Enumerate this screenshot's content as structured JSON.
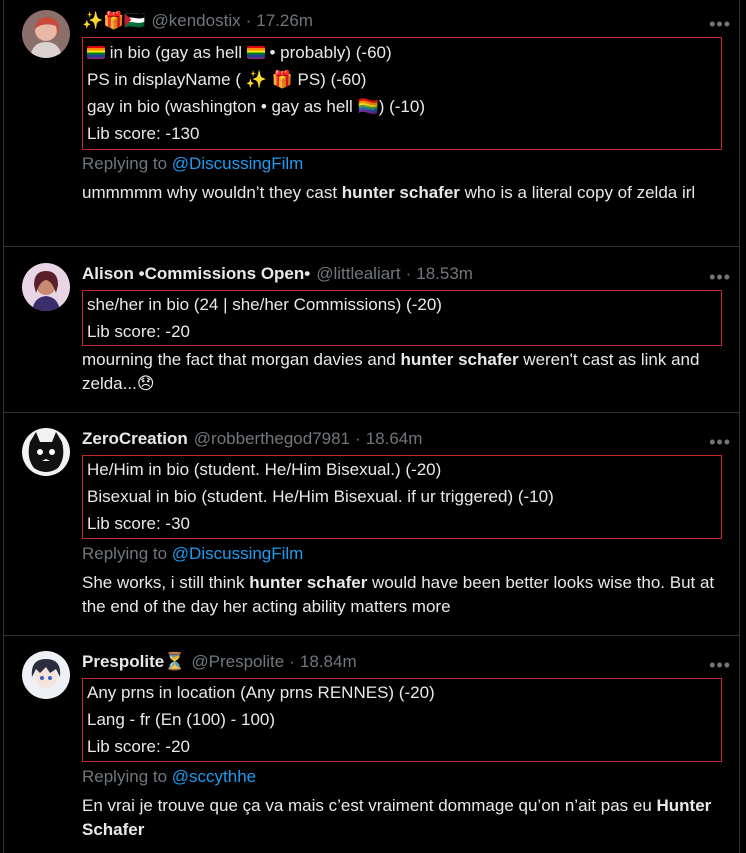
{
  "tweets": [
    {
      "name_emoji": "✨🎁🇵🇸",
      "name": "",
      "handle": "@kendostix",
      "time": "17.26m",
      "bio_lines": [
        {
          "pre": "",
          "text": " in bio (gay as hell ",
          "post": " • probably) (-60)"
        },
        {
          "text": "PS in displayName ( ✨ 🎁 PS) (-60)"
        },
        {
          "text": "gay in bio (washington • gay as hell 🏳️‍🌈) (-10)"
        },
        {
          "text": "Lib score: -130"
        }
      ],
      "reply_label": "Replying to",
      "reply_to": "@DiscussingFilm",
      "text_a": "ummmmm why wouldn’t they cast ",
      "text_bold": "hunter schafer",
      "text_b": " who is a literal copy of zelda irl"
    },
    {
      "name": "Alison •Commissions Open•",
      "handle": "@littlealiart",
      "time": "18.53m",
      "bio_lines": [
        {
          "text": "she/her in bio (24 | she/her Commissions) (-20)"
        },
        {
          "text": "Lib score: -20"
        }
      ],
      "text_a": "mourning the fact that morgan davies and ",
      "text_bold": "hunter schafer",
      "text_b": " weren't cast as link and zelda...",
      "text_emoji": "😞"
    },
    {
      "name": "ZeroCreation",
      "handle": "@robberthegod7981",
      "time": "18.64m",
      "bio_lines": [
        {
          "text": "He/Him in bio (student. He/Him Bisexual.) (-20)"
        },
        {
          "text": "Bisexual in bio (student. He/Him Bisexual. if ur triggered) (-10)"
        },
        {
          "text": "Lib score: -30"
        }
      ],
      "reply_label": "Replying to",
      "reply_to": "@DiscussingFilm",
      "text_a": "She works, i still think ",
      "text_bold": "hunter schafer",
      "text_b": " would have been better looks wise tho. But at the end of the day her acting ability matters more"
    },
    {
      "name": "Prespolite",
      "name_emoji": "⏳",
      "handle": "@Prespolite",
      "time": "18.84m",
      "bio_lines": [
        {
          "text": "Any prns in location (Any prns RENNES) (-20)"
        },
        {
          "text": "Lang - fr (En (100) - 100)"
        },
        {
          "text": "Lib score: -20"
        }
      ],
      "reply_label": "Replying to",
      "reply_to": "@sccythhe",
      "text_a": "En vrai je trouve que ça va mais c’est vraiment dommage qu’on n’ait pas eu ",
      "text_bold": "Hunter Schafer",
      "text_b": ""
    }
  ],
  "more_icon": "more-horizontal-icon",
  "dot": "·",
  "colors": {
    "accent": "#1d9bf0",
    "muted": "#71767b",
    "box": "#c62828",
    "bg": "#000000"
  }
}
